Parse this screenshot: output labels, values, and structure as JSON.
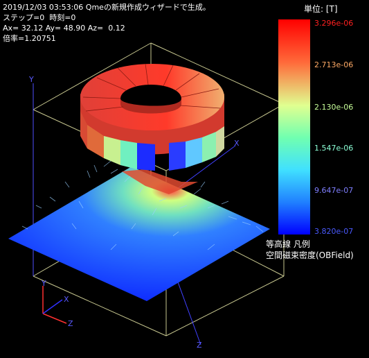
{
  "header": {
    "line1": "2019/12/03 03:53:06 Qmeの新規作成ウィザードで生成。",
    "line2": "ステップ=0  時刻=0",
    "line3": "Ax= 32.12 Ay= 48.90 Az=  0.12",
    "line4": "倍率=1.20751"
  },
  "legend": {
    "unit_label": "単位: [T]",
    "title_line1": "等高線 凡例",
    "title_line2": "空間磁束密度(OBField)",
    "levels": [
      "3.296e-06",
      "2.713e-06",
      "2.130e-06",
      "1.547e-06",
      "9.647e-07",
      "3.820e-07"
    ],
    "colors": [
      "#ff2020",
      "#ffaa66",
      "#c8ff9a",
      "#8cffd6",
      "#7f7fff",
      "#4a5aff"
    ]
  },
  "axes": {
    "main_x": "X",
    "main_y": "Y",
    "main_z": "Z",
    "mini_x": "X",
    "mini_y": "Y",
    "mini_z": "Z"
  },
  "colors": {
    "background": "#000000",
    "box_line": "#c8c890",
    "axis_y": "#5050ff",
    "axis_x": "#4040ff",
    "mini_axis_x": "#ff3030",
    "mini_axis_y": "#3030ff"
  }
}
